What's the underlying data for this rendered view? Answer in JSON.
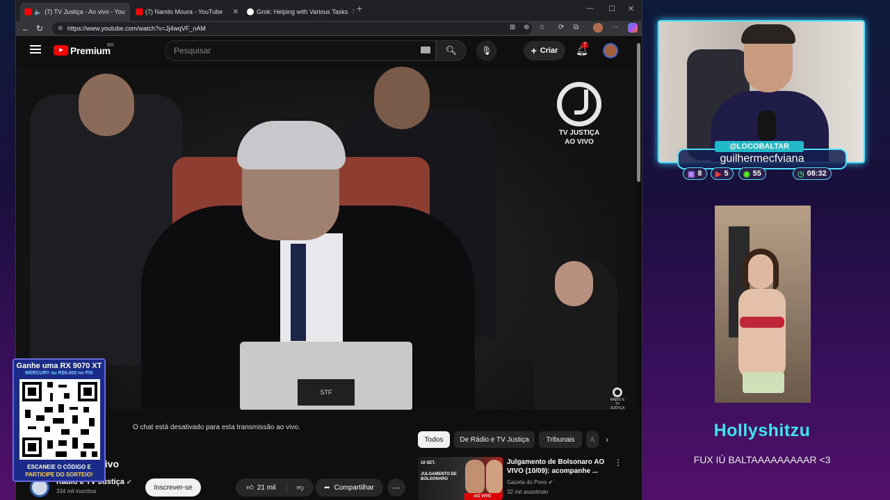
{
  "browser": {
    "tabs": [
      {
        "label": "(7) TV Justiça - Ao vivo - You",
        "icon": "youtube-icon",
        "audio": true
      },
      {
        "label": "(7) Nando Moura - YouTube",
        "icon": "youtube-icon"
      },
      {
        "label": "Grok: Helping with Various Tasks",
        "icon": "grok-icon"
      }
    ],
    "url": "https://www.youtube.com/watch?v=Jj4wqVF_nAM"
  },
  "youtube": {
    "logo_text": "Premium",
    "region": "BR",
    "search_placeholder": "Pesquisar",
    "create_label": "Criar",
    "notifications_count": "7"
  },
  "video": {
    "overlay_title": "TV JUSTIÇA",
    "overlay_subtitle": "AO VIVO",
    "stf_label": "STF",
    "corner_logo_text": "RÁDIO E TV JUSTIÇA"
  },
  "watch": {
    "chat_disabled": "O chat está desativado para esta transmissão ao vivo.",
    "title_fragment": "vivo",
    "channel_name": "Rádio e TV Justiça",
    "subscribers": "334 mil inscritos",
    "subscribe_label": "Inscrever-se",
    "likes": "21 mil",
    "share_label": "Compartilhar",
    "chips": [
      "Todos",
      "De Rádio e TV Justiça",
      "Tribunais",
      "A"
    ],
    "recommended": {
      "title": "Julgamento de Bolsonaro AO VIVO (10/09): acompanhe ...",
      "channel": "Gazeta do Povo",
      "viewers": "32 mil assistindo",
      "thumb_date": "10 SET.",
      "thumb_headline": "JULGAMENTO DE BOLSONARO",
      "thumb_live": "AO VIVO"
    }
  },
  "giveaway": {
    "title": "Ganhe uma RX 9070 XT",
    "subtitle": "MERCURY ou R$6.000 no PIX",
    "footer1": "ESCANEIE O CÓDIGO E",
    "footer2": "PARTICIPE DO SORTEIO!"
  },
  "streamer": {
    "handle": "@LOCOBALTAR",
    "name": "guilhermecfviana",
    "stats": [
      {
        "icon": "twitch-icon",
        "value": "8",
        "color": "#9146ff"
      },
      {
        "icon": "youtube-icon",
        "value": "5",
        "color": "#ff0000"
      },
      {
        "icon": "kick-icon",
        "value": "55",
        "color": "#53fc18"
      },
      {
        "icon": "clock-icon",
        "value": "08:32",
        "color": "#25d366"
      }
    ],
    "donor": "Hollyshitzu",
    "donation_message": "FUX IÚ BALTAAAAAAAAAR <3"
  }
}
